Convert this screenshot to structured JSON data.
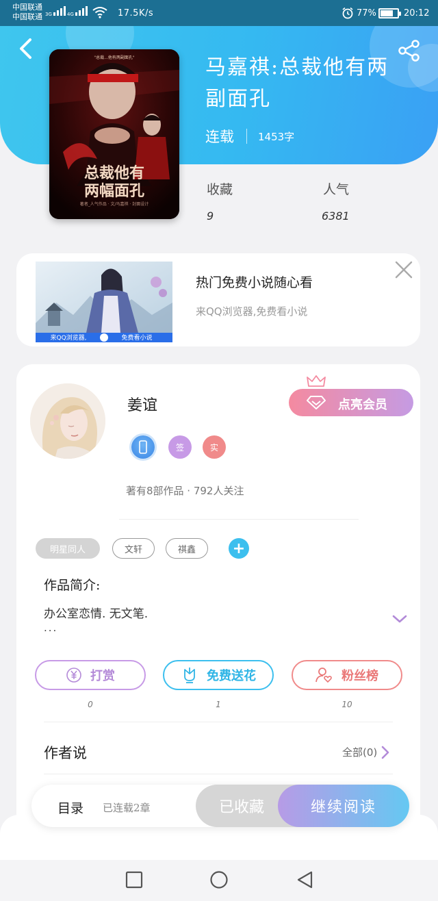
{
  "status_bar": {
    "carrier_1": "中国联通",
    "carrier_2": "中国联通",
    "net_1": "3G",
    "net_2": "4G",
    "speed": "17.5K/s",
    "battery": "77%",
    "battery_level": 0.77,
    "time": "20:12"
  },
  "book": {
    "title": "马嘉祺:总裁他有两副面孔",
    "status": "连载",
    "word_count": "1453字",
    "stats": [
      {
        "label": "收藏",
        "value": "9"
      },
      {
        "label": "人气",
        "value": "6381"
      }
    ],
    "cover": {
      "top_text": "\"总裁...他有两副面孔\"",
      "title_line1": "总裁他有",
      "title_line2": "两幅面孔",
      "caption": "著者_人气作品 · 文/马嘉祺 · 封面设计"
    }
  },
  "ad": {
    "title": "热门免费小说随心看",
    "subtitle": "来QQ浏览器,免费看小说",
    "banner_left": "来QQ浏览器,",
    "banner_right": "免费看小说"
  },
  "author": {
    "name": "姜谊",
    "badges": [
      {
        "icon": "phone-icon",
        "text": "",
        "color": "#4a9ff0"
      },
      {
        "icon": "sign-icon",
        "text": "签",
        "color": "#c79ae6"
      },
      {
        "icon": "real-name-icon",
        "text": "实",
        "color": "#f08a8a"
      }
    ],
    "vip_button": "点亮会员",
    "works_line": "著有8部作品 · 792人关注",
    "tags": [
      "明星同人",
      "文轩",
      "祺鑫"
    ],
    "intro_title": "作品简介:",
    "intro_text": "办公室恋情. 无文笔.",
    "intro_more": "...",
    "actions": [
      {
        "label": "打赏",
        "count": "0",
        "color": "#c79ae6",
        "icon": "yuan-icon"
      },
      {
        "label": "免费送花",
        "count": "1",
        "color": "#3cbfee",
        "icon": "flower-icon"
      },
      {
        "label": "粉丝榜",
        "count": "10",
        "color": "#f08a8a",
        "icon": "fans-icon"
      }
    ],
    "author_says": "作者说",
    "all_link": "全部(0)"
  },
  "read_bar": {
    "toc": "目录",
    "toc_sub": "已连载2章",
    "collected": "已收藏",
    "continue": "继续阅读"
  },
  "colors": {
    "header_blue": "#35b9f1",
    "accent_purple": "#c79ae6",
    "accent_pink": "#f08a8a",
    "accent_blue": "#3cbfee"
  }
}
